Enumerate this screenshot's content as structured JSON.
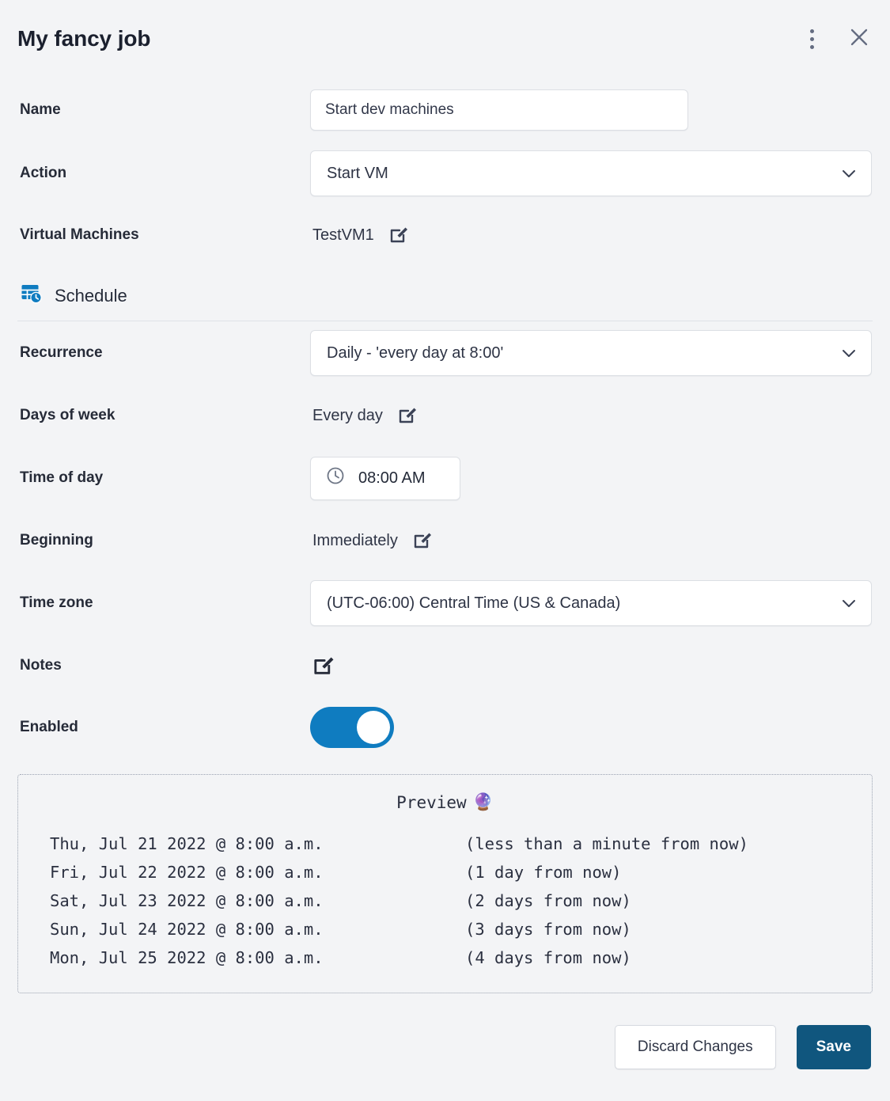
{
  "header": {
    "title": "My fancy job",
    "menu_icon": "kebab-menu-icon",
    "close_icon": "close-icon"
  },
  "form": {
    "name": {
      "label": "Name",
      "value": "Start dev machines",
      "placeholder": "Start dev machines"
    },
    "action": {
      "label": "Action",
      "value": "Start VM"
    },
    "virtual_machines": {
      "label": "Virtual Machines",
      "value": "TestVM1",
      "edit_icon": "edit-icon"
    }
  },
  "schedule": {
    "section_title": "Schedule",
    "section_icon": "schedule-calendar-clock-icon",
    "recurrence": {
      "label": "Recurrence",
      "value": "Daily - 'every day at 8:00'"
    },
    "days_of_week": {
      "label": "Days of week",
      "value": "Every day",
      "edit_icon": "edit-icon"
    },
    "time_of_day": {
      "label": "Time of day",
      "value": "08:00 AM",
      "clock_icon": "clock-icon"
    },
    "beginning": {
      "label": "Beginning",
      "value": "Immediately",
      "edit_icon": "edit-icon"
    },
    "time_zone": {
      "label": "Time zone",
      "value": "(UTC-06:00) Central Time (US & Canada)"
    },
    "notes": {
      "label": "Notes",
      "value": "",
      "edit_icon": "edit-icon"
    },
    "enabled": {
      "label": "Enabled",
      "state": "on"
    }
  },
  "preview": {
    "title": "Preview",
    "title_emoji": "🔮",
    "rows": [
      {
        "when": "Thu, Jul 21 2022 @ 8:00 a.m.",
        "relative": "(less than a minute from now)"
      },
      {
        "when": "Fri, Jul 22 2022 @ 8:00 a.m.",
        "relative": "(1 day from now)"
      },
      {
        "when": "Sat, Jul 23 2022 @ 8:00 a.m.",
        "relative": "(2 days from now)"
      },
      {
        "when": "Sun, Jul 24 2022 @ 8:00 a.m.",
        "relative": "(3 days from now)"
      },
      {
        "when": "Mon, Jul 25 2022 @ 8:00 a.m.",
        "relative": "(4 days from now)"
      }
    ]
  },
  "footer": {
    "discard_label": "Discard Changes",
    "save_label": "Save"
  },
  "colors": {
    "page_background": "#f3f4f6",
    "toggle_on": "#0f7cc0",
    "primary_button": "#10567e",
    "schedule_icon": "#0f7cc0",
    "text": "#1f2430"
  }
}
